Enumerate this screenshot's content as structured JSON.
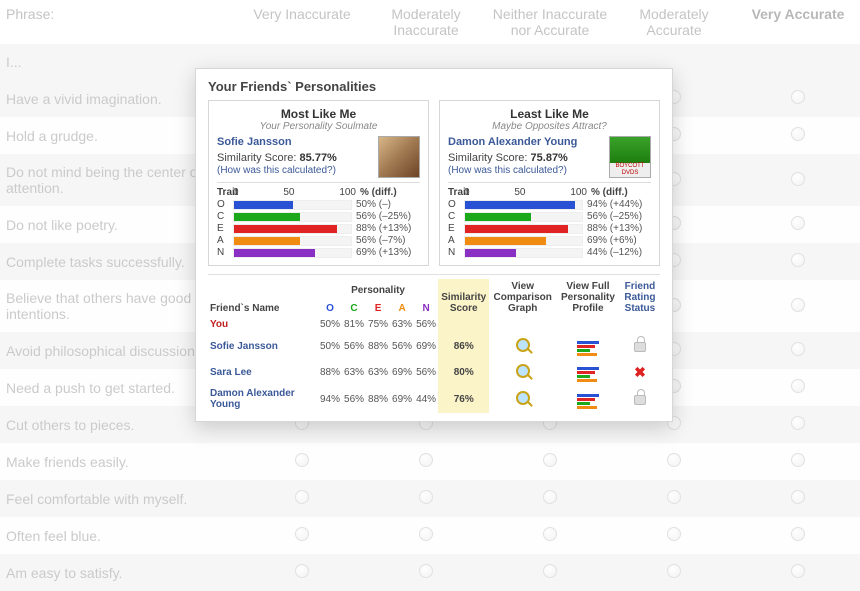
{
  "survey": {
    "header": [
      "Phrase:",
      "Very Inaccurate",
      "Moderately Inaccurate",
      "Neither Inaccurate nor Accurate",
      "Moderately Accurate",
      "Very Accurate"
    ],
    "lead": "I...",
    "rows": [
      "Have a vivid imagination.",
      "Hold a grudge.",
      "Do not mind being the center of attention.",
      "Do not like poetry.",
      "Complete tasks successfully.",
      "Believe that others have good intentions.",
      "Avoid philosophical discussions.",
      "Need a push to get started.",
      "Cut others to pieces.",
      "Make friends easily.",
      "Feel comfortable with myself.",
      "Often feel blue.",
      "Am easy to satisfy."
    ]
  },
  "card": {
    "title": "Your Friends` Personalities",
    "trait_header": {
      "label": "Trait",
      "ticks": [
        "0",
        "50",
        "100"
      ],
      "pct_label": "% (diff.)"
    },
    "most": {
      "heading": "Most Like Me",
      "sub": "Your Personality Soulmate",
      "name": "Sofie Jansson",
      "score_label": "Similarity Score:",
      "score": "85.77%",
      "how": "(How was this calculated?)",
      "traits": [
        {
          "k": "O",
          "pct": 50,
          "diff": "(–)"
        },
        {
          "k": "C",
          "pct": 56,
          "diff": "(–25%)"
        },
        {
          "k": "E",
          "pct": 88,
          "diff": "(+13%)"
        },
        {
          "k": "A",
          "pct": 56,
          "diff": "(–7%)"
        },
        {
          "k": "N",
          "pct": 69,
          "diff": "(+13%)"
        }
      ]
    },
    "least": {
      "heading": "Least Like Me",
      "sub": "Maybe Opposites Attract?",
      "name": "Damon Alexander Young",
      "score_label": "Similarity Score:",
      "score": "75.87%",
      "how": "(How was this calculated?)",
      "traits": [
        {
          "k": "O",
          "pct": 94,
          "diff": "(+44%)"
        },
        {
          "k": "C",
          "pct": 56,
          "diff": "(–25%)"
        },
        {
          "k": "E",
          "pct": 88,
          "diff": "(+13%)"
        },
        {
          "k": "A",
          "pct": 69,
          "diff": "(+6%)"
        },
        {
          "k": "N",
          "pct": 44,
          "diff": "(–12%)"
        }
      ]
    },
    "table": {
      "headers": {
        "name": "Friend`s Name",
        "group": "Personality",
        "traits": [
          "O",
          "C",
          "E",
          "A",
          "N"
        ],
        "sim": "Similarity Score",
        "graph": "View Comparison Graph",
        "profile": "View Full Personality Profile",
        "status": "Friend Rating Status"
      },
      "rows": [
        {
          "name": "You",
          "you": true,
          "vals": [
            "50%",
            "81%",
            "75%",
            "63%",
            "56%"
          ],
          "sim": "",
          "icons": false
        },
        {
          "name": "Sofie Jansson",
          "vals": [
            "50%",
            "56%",
            "88%",
            "56%",
            "69%"
          ],
          "sim": "86%",
          "status": "lock"
        },
        {
          "name": "Sara Lee",
          "vals": [
            "88%",
            "63%",
            "63%",
            "69%",
            "56%"
          ],
          "sim": "80%",
          "status": "x"
        },
        {
          "name": "Damon Alexander Young",
          "vals": [
            "94%",
            "56%",
            "88%",
            "69%",
            "44%"
          ],
          "sim": "76%",
          "status": "lock"
        }
      ]
    }
  }
}
